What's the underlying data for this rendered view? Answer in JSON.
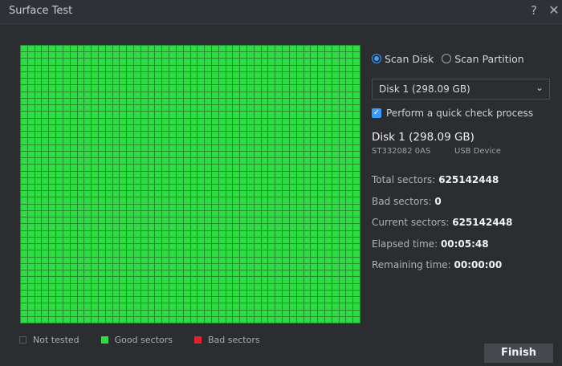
{
  "window": {
    "title": "Surface Test",
    "help_icon": "?",
    "close_icon": "✕"
  },
  "scan_grid": {
    "status": "good",
    "good_color": "#2fdb43",
    "not_tested_color": "#2b2d31",
    "bad_color": "#e2222b"
  },
  "legend": {
    "not_tested": "Not tested",
    "good": "Good sectors",
    "bad": "Bad sectors"
  },
  "options": {
    "scan_disk": "Scan Disk",
    "scan_partition": "Scan Partition",
    "selected": "scan_disk",
    "disk_select_value": "Disk 1 (298.09 GB)",
    "quick_check_label": "Perform a quick check process",
    "quick_check_checked": true
  },
  "disk": {
    "name": "Disk 1 (298.09 GB)",
    "model": "ST332082 0AS",
    "connection": "USB Device"
  },
  "stats": {
    "total_label": "Total sectors:",
    "total_value": "625142448",
    "bad_label": "Bad sectors:",
    "bad_value": "0",
    "current_label": "Current sectors:",
    "current_value": "625142448",
    "elapsed_label": "Elapsed time:",
    "elapsed_value": "00:05:48",
    "remaining_label": "Remaining time:",
    "remaining_value": "00:00:00"
  },
  "actions": {
    "finish": "Finish"
  },
  "accent_color": "#3b9bff"
}
